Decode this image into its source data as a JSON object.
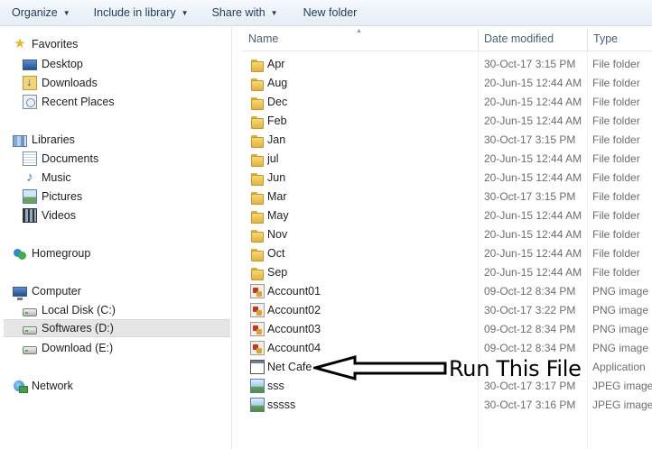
{
  "toolbar": {
    "items": [
      {
        "label": "Organize",
        "has_dropdown": true
      },
      {
        "label": "Include in library",
        "has_dropdown": true
      },
      {
        "label": "Share with",
        "has_dropdown": true
      },
      {
        "label": "New folder",
        "has_dropdown": false
      }
    ]
  },
  "nav": {
    "favorites": {
      "label": "Favorites",
      "icon": "star-icon",
      "items": [
        {
          "label": "Desktop",
          "icon": "desktop-icon"
        },
        {
          "label": "Downloads",
          "icon": "downloads-icon"
        },
        {
          "label": "Recent Places",
          "icon": "recent-places-icon"
        }
      ]
    },
    "libraries": {
      "label": "Libraries",
      "icon": "libraries-icon",
      "items": [
        {
          "label": "Documents",
          "icon": "documents-icon"
        },
        {
          "label": "Music",
          "icon": "music-icon"
        },
        {
          "label": "Pictures",
          "icon": "pictures-icon"
        },
        {
          "label": "Videos",
          "icon": "videos-icon"
        }
      ]
    },
    "homegroup": {
      "label": "Homegroup",
      "icon": "homegroup-icon"
    },
    "computer": {
      "label": "Computer",
      "icon": "computer-icon",
      "items": [
        {
          "label": "Local Disk (C:)",
          "icon": "drive-icon",
          "selected": false
        },
        {
          "label": "Softwares (D:)",
          "icon": "drive-icon",
          "selected": true
        },
        {
          "label": "Download (E:)",
          "icon": "drive-icon",
          "selected": false
        }
      ]
    },
    "network": {
      "label": "Network",
      "icon": "network-icon"
    }
  },
  "columns": {
    "name": "Name",
    "date": "Date modified",
    "type": "Type"
  },
  "files": [
    {
      "name": "Apr",
      "date": "30-Oct-17 3:15 PM",
      "type": "File folder",
      "icon": "folder-icon"
    },
    {
      "name": "Aug",
      "date": "20-Jun-15 12:44 AM",
      "type": "File folder",
      "icon": "folder-icon"
    },
    {
      "name": "Dec",
      "date": "20-Jun-15 12:44 AM",
      "type": "File folder",
      "icon": "folder-icon"
    },
    {
      "name": "Feb",
      "date": "20-Jun-15 12:44 AM",
      "type": "File folder",
      "icon": "folder-icon"
    },
    {
      "name": "Jan",
      "date": "30-Oct-17 3:15 PM",
      "type": "File folder",
      "icon": "folder-icon"
    },
    {
      "name": "jul",
      "date": "20-Jun-15 12:44 AM",
      "type": "File folder",
      "icon": "folder-icon"
    },
    {
      "name": "Jun",
      "date": "20-Jun-15 12:44 AM",
      "type": "File folder",
      "icon": "folder-icon"
    },
    {
      "name": "Mar",
      "date": "30-Oct-17 3:15 PM",
      "type": "File folder",
      "icon": "folder-icon"
    },
    {
      "name": "May",
      "date": "20-Jun-15 12:44 AM",
      "type": "File folder",
      "icon": "folder-icon"
    },
    {
      "name": "Nov",
      "date": "20-Jun-15 12:44 AM",
      "type": "File folder",
      "icon": "folder-icon"
    },
    {
      "name": "Oct",
      "date": "20-Jun-15 12:44 AM",
      "type": "File folder",
      "icon": "folder-icon"
    },
    {
      "name": "Sep",
      "date": "20-Jun-15 12:44 AM",
      "type": "File folder",
      "icon": "folder-icon"
    },
    {
      "name": "Account01",
      "date": "09-Oct-12 8:34 PM",
      "type": "PNG image",
      "icon": "png-image-icon"
    },
    {
      "name": "Account02",
      "date": "30-Oct-17 3:22 PM",
      "type": "PNG image",
      "icon": "png-image-icon"
    },
    {
      "name": "Account03",
      "date": "09-Oct-12 8:34 PM",
      "type": "PNG image",
      "icon": "png-image-icon"
    },
    {
      "name": "Account04",
      "date": "09-Oct-12 8:34 PM",
      "type": "PNG image",
      "icon": "png-image-icon"
    },
    {
      "name": "Net Cafe",
      "date": "",
      "type": "Application",
      "icon": "application-icon"
    },
    {
      "name": "sss",
      "date": "30-Oct-17 3:17 PM",
      "type": "JPEG image",
      "icon": "jpeg-image-icon"
    },
    {
      "name": "sssss",
      "date": "30-Oct-17 3:16 PM",
      "type": "JPEG image",
      "icon": "jpeg-image-icon"
    }
  ],
  "annotation": {
    "text": "Run This File",
    "icon": "arrow-left-icon"
  }
}
